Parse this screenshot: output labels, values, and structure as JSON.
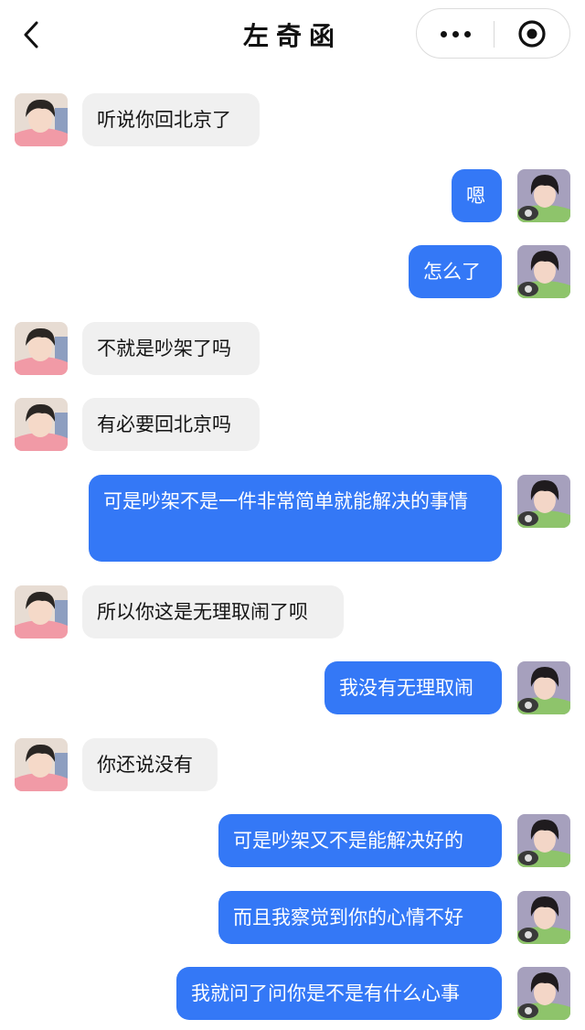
{
  "header": {
    "title": "左奇函",
    "back_icon": "chevron-left-icon",
    "more_icon": "more-dots-icon",
    "close_icon": "target-circle-icon"
  },
  "colors": {
    "outgoing_bubble": "#3478f6",
    "incoming_bubble": "#f0f0f0",
    "outgoing_text": "#ffffff",
    "incoming_text": "#141414"
  },
  "messages": [
    {
      "side": "left",
      "text": "听说你回北京了"
    },
    {
      "side": "right",
      "text": "嗯"
    },
    {
      "side": "right",
      "text": "怎么了"
    },
    {
      "side": "left",
      "text": "不就是吵架了吗"
    },
    {
      "side": "left",
      "text": "有必要回北京吗"
    },
    {
      "side": "right",
      "text": "可是吵架不是一件非常简单就能解决的事情"
    },
    {
      "side": "left",
      "text": "所以你这是无理取闹了呗"
    },
    {
      "side": "right",
      "text": "我没有无理取闹"
    },
    {
      "side": "left",
      "text": "你还说没有"
    },
    {
      "side": "right",
      "text": "可是吵架又不是能解决好的"
    },
    {
      "side": "right",
      "text": "而且我察觉到你的心情不好"
    },
    {
      "side": "right",
      "text": "我就问了问你是不是有什么心事"
    }
  ]
}
